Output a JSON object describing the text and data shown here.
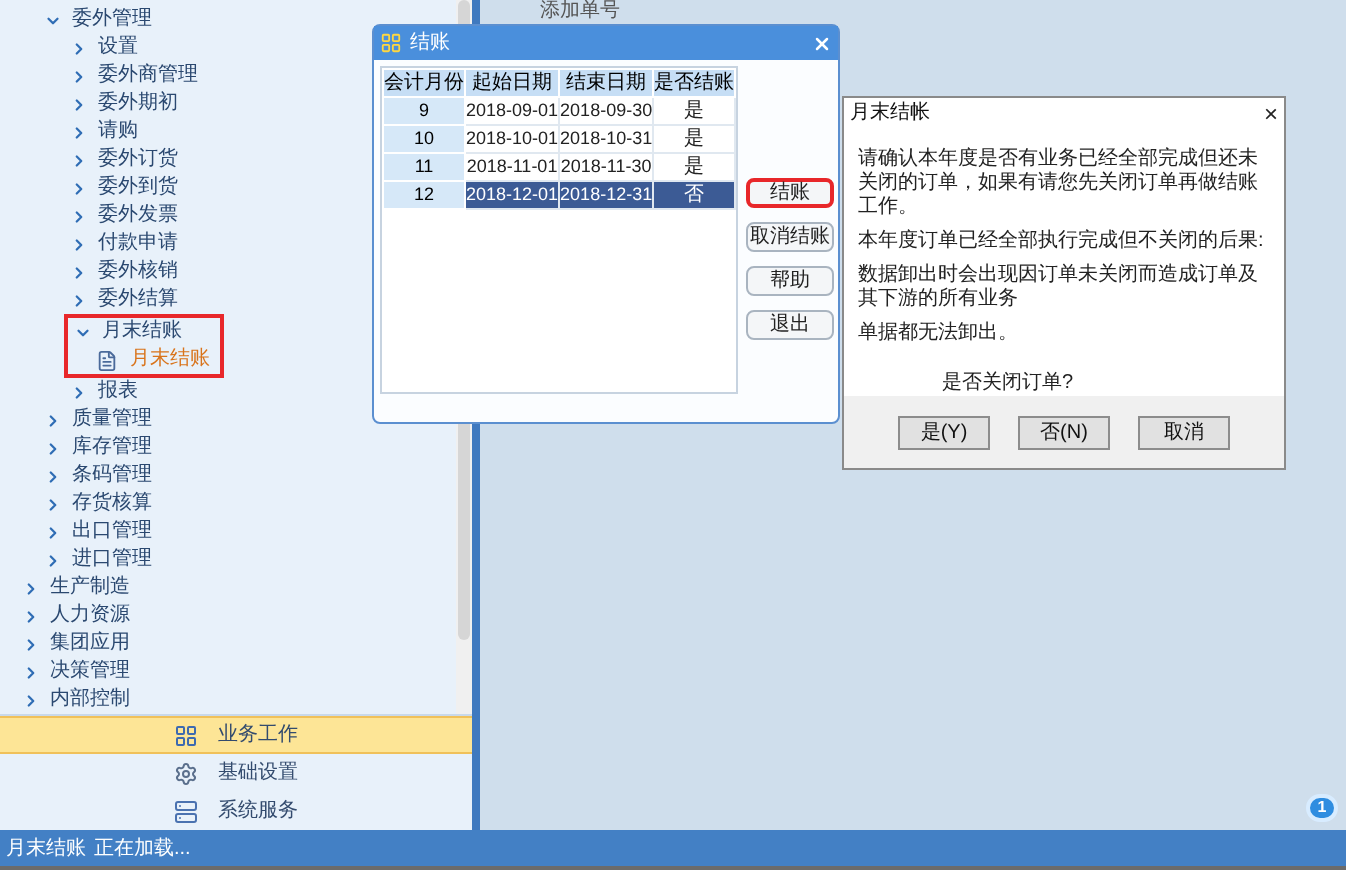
{
  "tree": [
    {
      "label": "委外管理",
      "kind": "folder",
      "expanded": true,
      "highlighted": false,
      "children": [
        {
          "label": "设置",
          "kind": "folder",
          "expanded": false,
          "highlighted": false
        },
        {
          "label": "委外商管理",
          "kind": "folder",
          "expanded": false,
          "highlighted": false
        },
        {
          "label": "委外期初",
          "kind": "folder",
          "expanded": false,
          "highlighted": false
        },
        {
          "label": "请购",
          "kind": "folder",
          "expanded": false,
          "highlighted": false
        },
        {
          "label": "委外订货",
          "kind": "folder",
          "expanded": false,
          "highlighted": false
        },
        {
          "label": "委外到货",
          "kind": "folder",
          "expanded": false,
          "highlighted": false
        },
        {
          "label": "委外发票",
          "kind": "folder",
          "expanded": false,
          "highlighted": false
        },
        {
          "label": "付款申请",
          "kind": "folder",
          "expanded": false,
          "highlighted": false
        },
        {
          "label": "委外核销",
          "kind": "folder",
          "expanded": false,
          "highlighted": false
        },
        {
          "label": "委外结算",
          "kind": "folder",
          "expanded": false,
          "highlighted": false
        },
        {
          "label": "月末结账",
          "kind": "folder",
          "expanded": true,
          "highlighted": true,
          "children": [
            {
              "label": "月末结账",
              "kind": "document",
              "selected": true
            }
          ]
        },
        {
          "label": "报表",
          "kind": "folder",
          "expanded": false,
          "highlighted": false
        }
      ]
    },
    {
      "label": "质量管理",
      "kind": "folder",
      "expanded": false,
      "highlighted": false
    },
    {
      "label": "库存管理",
      "kind": "folder",
      "expanded": false,
      "highlighted": false
    },
    {
      "label": "条码管理",
      "kind": "folder",
      "expanded": false,
      "highlighted": false
    },
    {
      "label": "存货核算",
      "kind": "folder",
      "expanded": false,
      "highlighted": false
    },
    {
      "label": "出口管理",
      "kind": "folder",
      "expanded": false,
      "highlighted": false
    },
    {
      "label": "进口管理",
      "kind": "folder",
      "expanded": false,
      "highlighted": false
    }
  ],
  "top_modules": [
    {
      "label": "生产制造",
      "expanded": false
    },
    {
      "label": "人力资源",
      "expanded": false
    },
    {
      "label": "集团应用",
      "expanded": false
    },
    {
      "label": "决策管理",
      "expanded": false
    },
    {
      "label": "内部控制",
      "expanded": false
    }
  ],
  "nav": [
    {
      "label": "业务工作",
      "kind": "work",
      "selected": true
    },
    {
      "label": "基础设置",
      "kind": "settings",
      "selected": false
    },
    {
      "label": "系统服务",
      "kind": "service",
      "selected": false
    }
  ],
  "status_bar": {
    "module": "月末结账",
    "message": "正在加载..."
  },
  "content": {
    "top_label": "添加单号",
    "badge": "1"
  },
  "close_dialog": {
    "title": "结账",
    "columns": [
      "会计月份",
      "起始日期",
      "结束日期",
      "是否结账"
    ],
    "rows": [
      {
        "month": "9",
        "start": "2018-09-01",
        "end": "2018-09-30",
        "closed": "是",
        "selected": false
      },
      {
        "month": "10",
        "start": "2018-10-01",
        "end": "2018-10-31",
        "closed": "是",
        "selected": false
      },
      {
        "month": "11",
        "start": "2018-11-01",
        "end": "2018-11-30",
        "closed": "是",
        "selected": false
      },
      {
        "month": "12",
        "start": "2018-12-01",
        "end": "2018-12-31",
        "closed": "否",
        "selected": true
      }
    ],
    "buttons": [
      {
        "label": "结账",
        "highlighted": true
      },
      {
        "label": "取消结账",
        "highlighted": false
      },
      {
        "label": "帮助",
        "highlighted": false
      },
      {
        "label": "退出",
        "highlighted": false
      }
    ]
  },
  "confirm_dialog": {
    "title": "月末结帐",
    "close": "×",
    "paragraphs": [
      "请确认本年度是否有业务已经全部完成但还未关闭的订单，如果有请您先关闭订单再做结账工作。",
      "本年度订单已经全部执行完成但不关闭的后果:",
      "数据卸出时会出现因订单未关闭而造成订单及其下游的所有业务",
      "单据都无法卸出。"
    ],
    "question": "是否关闭订单?",
    "buttons": [
      "是(Y)",
      "否(N)",
      "取消"
    ]
  }
}
